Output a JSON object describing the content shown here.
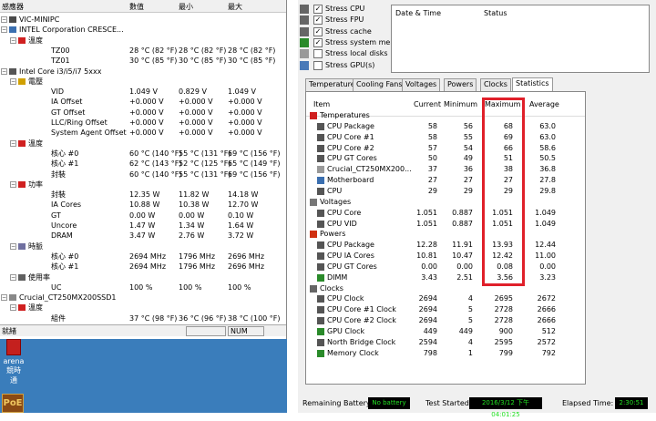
{
  "left": {
    "headers": {
      "c0": "感應器",
      "c1": "數值",
      "c2": "最小",
      "c3": "最大"
    },
    "rows": [
      {
        "label": "VIC-MINIPC",
        "type": "root"
      },
      {
        "label": "INTEL Corporation CRESCE...",
        "type": "board"
      },
      {
        "label": "溫度",
        "type": "cat-temp"
      },
      {
        "label": "TZ00",
        "v1": "28 °C  (82 °F)",
        "v2": "28 °C  (82 °F)",
        "v3": "28 °C  (82 °F)"
      },
      {
        "label": "TZ01",
        "v1": "30 °C  (85 °F)",
        "v2": "30 °C  (85 °F)",
        "v3": "30 °C  (85 °F)"
      },
      {
        "label": "Intel Core i3/i5/i7 5xxx",
        "type": "cpu"
      },
      {
        "label": "電壓",
        "type": "cat-volt"
      },
      {
        "label": "VID",
        "v1": "1.049 V",
        "v2": "0.829 V",
        "v3": "1.049 V"
      },
      {
        "label": "IA Offset",
        "v1": "+0.000 V",
        "v2": "+0.000 V",
        "v3": "+0.000 V"
      },
      {
        "label": "GT Offset",
        "v1": "+0.000 V",
        "v2": "+0.000 V",
        "v3": "+0.000 V"
      },
      {
        "label": "LLC/Ring Offset",
        "v1": "+0.000 V",
        "v2": "+0.000 V",
        "v3": "+0.000 V"
      },
      {
        "label": "System Agent Offset",
        "v1": "+0.000 V",
        "v2": "+0.000 V",
        "v3": "+0.000 V"
      },
      {
        "label": "溫度",
        "type": "cat-temp"
      },
      {
        "label": "核心 #0",
        "v1": "60 °C  (140 °F)",
        "v2": "55 °C  (131 °F)",
        "v3": "69 °C  (156 °F)"
      },
      {
        "label": "核心 #1",
        "v1": "62 °C  (143 °F)",
        "v2": "52 °C  (125 °F)",
        "v3": "65 °C  (149 °F)"
      },
      {
        "label": "封裝",
        "v1": "60 °C  (140 °F)",
        "v2": "55 °C  (131 °F)",
        "v3": "69 °C  (156 °F)"
      },
      {
        "label": "功率",
        "type": "cat-power"
      },
      {
        "label": "封裝",
        "v1": "12.35 W",
        "v2": "11.82 W",
        "v3": "14.18 W"
      },
      {
        "label": "IA Cores",
        "v1": "10.88 W",
        "v2": "10.38 W",
        "v3": "12.70 W"
      },
      {
        "label": "GT",
        "v1": "0.00 W",
        "v2": "0.00 W",
        "v3": "0.10 W"
      },
      {
        "label": "Uncore",
        "v1": "1.47 W",
        "v2": "1.34 W",
        "v3": "1.64 W"
      },
      {
        "label": "DRAM",
        "v1": "3.47 W",
        "v2": "2.76 W",
        "v3": "3.72 W"
      },
      {
        "label": "時脈",
        "type": "cat-clock"
      },
      {
        "label": "核心 #0",
        "v1": "2694 MHz",
        "v2": "1796 MHz",
        "v3": "2696 MHz"
      },
      {
        "label": "核心 #1",
        "v1": "2694 MHz",
        "v2": "1796 MHz",
        "v3": "2696 MHz"
      },
      {
        "label": "使用率",
        "type": "cat-load"
      },
      {
        "label": "UC",
        "v1": "100 %",
        "v2": "100 %",
        "v3": "100 %"
      },
      {
        "label": "Crucial_CT250MX200SSD1",
        "type": "disk"
      },
      {
        "label": "溫度",
        "type": "cat-temp"
      },
      {
        "label": "組件",
        "v1": "37 °C  (98 °F)",
        "v2": "36 °C  (96 °F)",
        "v3": "38 °C  (100 °F)"
      }
    ],
    "status": {
      "text": "就緒",
      "num": "NUM"
    }
  },
  "desktop": {
    "icon1_line1": "arena 競時",
    "icon1_line2": "通",
    "icon2": "PoE"
  },
  "stress": [
    {
      "label": "Stress CPU",
      "checked": true,
      "icon": "cpu-chip-icon"
    },
    {
      "label": "Stress FPU",
      "checked": true,
      "icon": "fpu-chip-icon"
    },
    {
      "label": "Stress cache",
      "checked": true,
      "icon": "cache-chip-icon"
    },
    {
      "label": "Stress system memory",
      "checked": true,
      "icon": "memory-module-icon"
    },
    {
      "label": "Stress local disks",
      "checked": false,
      "icon": "disk-drive-icon"
    },
    {
      "label": "Stress GPU(s)",
      "checked": false,
      "icon": "gpu-card-icon"
    }
  ],
  "datetime": {
    "col1": "Date & Time",
    "col2": "Status"
  },
  "tabs": [
    "Temperatures",
    "Cooling Fans",
    "Voltages",
    "Powers",
    "Clocks",
    "Statistics"
  ],
  "active_tab": "Statistics",
  "stats": {
    "headers": {
      "item": "Item",
      "current": "Current",
      "minimum": "Minimum",
      "maximum": "Maximum",
      "average": "Average"
    },
    "rows": [
      {
        "label": "Temperatures",
        "group": true,
        "icon": "thermometer-icon"
      },
      {
        "label": "CPU Package",
        "cur": "58",
        "min": "56",
        "max": "68",
        "avg": "63.0",
        "icon": "chip-icon"
      },
      {
        "label": "CPU Core #1",
        "cur": "58",
        "min": "55",
        "max": "69",
        "avg": "63.0",
        "icon": "chip-icon"
      },
      {
        "label": "CPU Core #2",
        "cur": "57",
        "min": "54",
        "max": "66",
        "avg": "58.6",
        "icon": "chip-icon"
      },
      {
        "label": "CPU GT Cores",
        "cur": "50",
        "min": "49",
        "max": "51",
        "avg": "50.5",
        "icon": "chip-icon"
      },
      {
        "label": "Crucial_CT250MX200...",
        "cur": "37",
        "min": "36",
        "max": "38",
        "avg": "36.8",
        "icon": "disk-icon"
      },
      {
        "label": "Motherboard",
        "cur": "27",
        "min": "27",
        "max": "27",
        "avg": "27.8",
        "icon": "board-icon"
      },
      {
        "label": "CPU",
        "cur": "29",
        "min": "29",
        "max": "29",
        "avg": "29.8",
        "icon": "chip-icon"
      },
      {
        "label": "Voltages",
        "group": true,
        "icon": "voltage-icon"
      },
      {
        "label": "CPU Core",
        "cur": "1.051",
        "min": "0.887",
        "max": "1.051",
        "avg": "1.049",
        "icon": "chip-icon"
      },
      {
        "label": "CPU VID",
        "cur": "1.051",
        "min": "0.887",
        "max": "1.051",
        "avg": "1.049",
        "icon": "chip-icon"
      },
      {
        "label": "Powers",
        "group": true,
        "icon": "power-icon"
      },
      {
        "label": "CPU Package",
        "cur": "12.28",
        "min": "11.91",
        "max": "13.93",
        "avg": "12.44",
        "icon": "chip-icon"
      },
      {
        "label": "CPU IA Cores",
        "cur": "10.81",
        "min": "10.47",
        "max": "12.42",
        "avg": "11.00",
        "icon": "chip-icon"
      },
      {
        "label": "CPU GT Cores",
        "cur": "0.00",
        "min": "0.00",
        "max": "0.08",
        "avg": "0.00",
        "icon": "chip-icon"
      },
      {
        "label": "DIMM",
        "cur": "3.43",
        "min": "2.51",
        "max": "3.56",
        "avg": "3.23",
        "icon": "memory-icon"
      },
      {
        "label": "Clocks",
        "group": true,
        "icon": "clock-icon"
      },
      {
        "label": "CPU Clock",
        "cur": "2694",
        "min": "4",
        "max": "2695",
        "avg": "2672",
        "icon": "chip-icon"
      },
      {
        "label": "CPU Core #1 Clock",
        "cur": "2694",
        "min": "5",
        "max": "2728",
        "avg": "2666",
        "icon": "chip-icon"
      },
      {
        "label": "CPU Core #2 Clock",
        "cur": "2694",
        "min": "5",
        "max": "2728",
        "avg": "2666",
        "icon": "chip-icon"
      },
      {
        "label": "GPU Clock",
        "cur": "449",
        "min": "449",
        "max": "900",
        "avg": "512",
        "icon": "gpu-icon"
      },
      {
        "label": "North Bridge Clock",
        "cur": "2594",
        "min": "4",
        "max": "2595",
        "avg": "2572",
        "icon": "chip-icon"
      },
      {
        "label": "Memory Clock",
        "cur": "798",
        "min": "1",
        "max": "799",
        "avg": "792",
        "icon": "memory-icon"
      }
    ]
  },
  "bottom": {
    "battery_label": "Remaining Battery:",
    "battery_value": "No battery",
    "started_label": "Test Started:",
    "started_value": "2016/3/12 下午 04:01:25",
    "elapsed_label": "Elapsed Time:",
    "elapsed_value": "2:30:51"
  },
  "colors": {
    "highlight": "#e0202a",
    "lcd_bg": "#000000",
    "lcd_text": "#22e022",
    "desktop": "#3a7dbb"
  }
}
